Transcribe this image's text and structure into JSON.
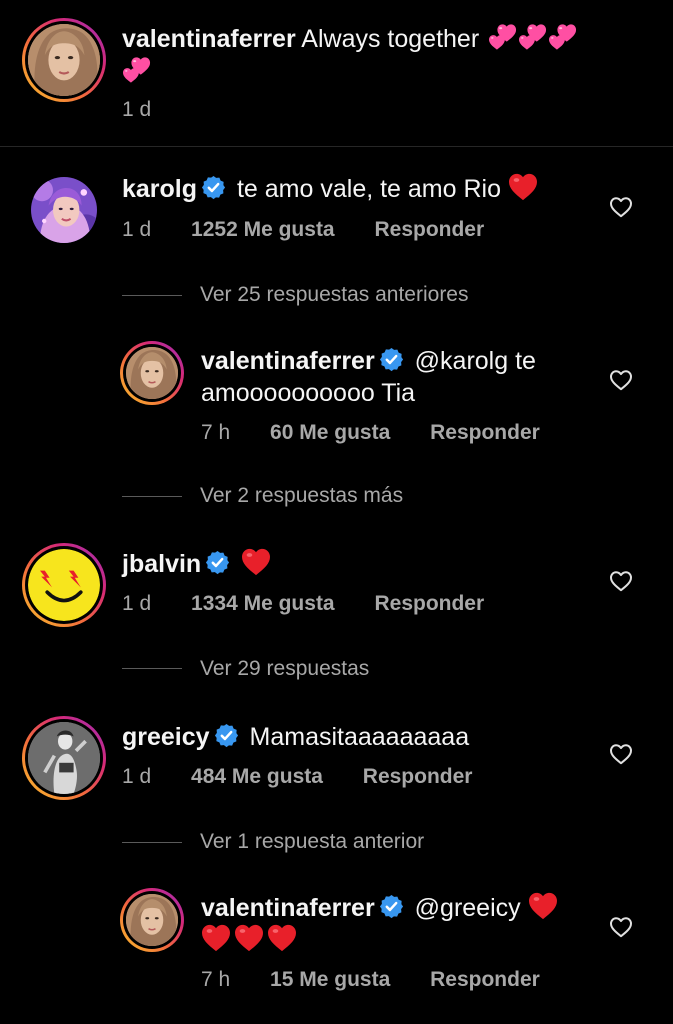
{
  "caption": {
    "username": "valentinaferrer",
    "text": "Always together",
    "time": "1 d"
  },
  "comments": [
    {
      "username": "karolg",
      "text": "te amo vale, te amo Rio",
      "time": "1 d",
      "likes": "1252 Me gusta",
      "reply_label": "Responder",
      "view_replies": "Ver 25 respuestas anteriores"
    },
    {
      "username": "valentinaferrer",
      "mention": "@karolg",
      "text_line1": "te",
      "text_line2": "amoooooooooo Tia",
      "time": "7 h",
      "likes": "60 Me gusta",
      "reply_label": "Responder",
      "view_replies": "Ver 2 respuestas más"
    },
    {
      "username": "jbalvin",
      "time": "1 d",
      "likes": "1334 Me gusta",
      "reply_label": "Responder",
      "view_replies": "Ver 29 respuestas"
    },
    {
      "username": "greeicy",
      "text": "Mamasitaaaaaaaaa",
      "time": "1 d",
      "likes": "484 Me gusta",
      "reply_label": "Responder",
      "view_replies": "Ver 1 respuesta anterior"
    },
    {
      "username": "valentinaferrer",
      "mention": "@greeicy",
      "time": "7 h",
      "likes": "15 Me gusta",
      "reply_label": "Responder"
    }
  ],
  "icons": {
    "verified": "verified-badge-icon",
    "heart_emoji": "red-heart-emoji",
    "two_hearts": "two-hearts-emoji",
    "like": "heart-outline-icon"
  },
  "colors": {
    "background": "#000000",
    "text_primary": "#f5f5f5",
    "text_secondary": "#a8a8a8",
    "verified_blue": "#3897f0",
    "heart_red": "#e8202a",
    "pink_hearts": "#ff4fa3"
  }
}
